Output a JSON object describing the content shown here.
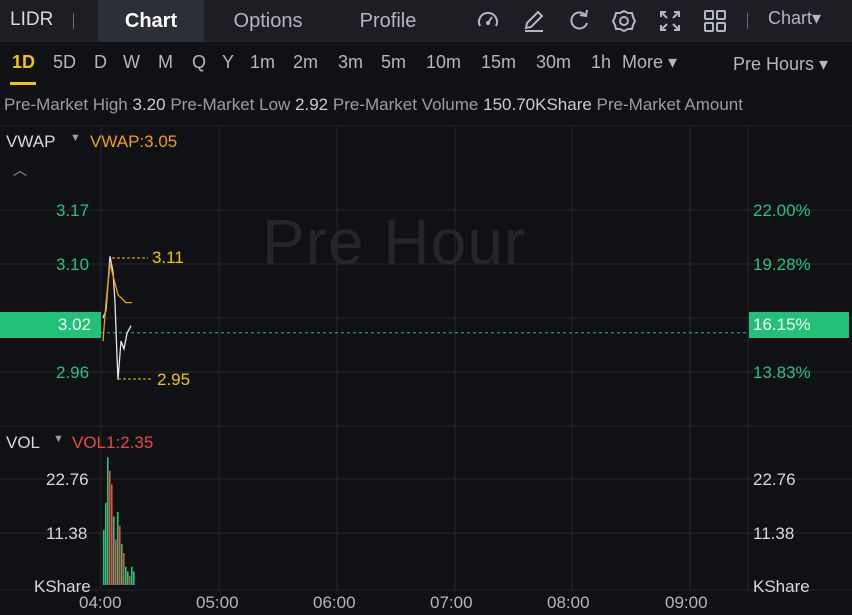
{
  "header": {
    "ticker": "LIDR",
    "tabs": [
      "Chart",
      "Options",
      "Profile"
    ],
    "active_tab": "Chart",
    "chart_menu": "Chart▾",
    "icons": [
      "gauge-icon",
      "draw-icon",
      "refresh-icon",
      "settings-icon",
      "fullscreen-icon",
      "layout-icon"
    ]
  },
  "intervals": {
    "items": [
      "1D",
      "5D",
      "D",
      "W",
      "M",
      "Q",
      "Y",
      "1m",
      "2m",
      "3m",
      "5m",
      "10m",
      "15m",
      "30m",
      "1h"
    ],
    "active": "1D",
    "more": "More ▾",
    "session": "Pre Hours ▾"
  },
  "stats": {
    "high_label": "Pre-Market High",
    "high_value": "3.20",
    "low_label": "Pre-Market Low",
    "low_value": "2.92",
    "volume_label": "Pre-Market Volume",
    "volume_value": "150.70KShare",
    "amount_label": "Pre-Market Amount"
  },
  "price_panel": {
    "indicator": "VWAP",
    "indicator_value": "VWAP:3.05",
    "watermark": "Pre Hour",
    "left_ticks": [
      "3.17",
      "3.10",
      "2.96"
    ],
    "right_ticks": [
      "22.00%",
      "19.28%",
      "13.83%"
    ],
    "current_price": "3.02",
    "current_pct": "16.15%",
    "high_marker": "3.11",
    "low_marker": "2.95",
    "colors": {
      "up": "#26c281",
      "vwap": "#f39c12",
      "marker": "#f1c40f"
    }
  },
  "volume_panel": {
    "indicator": "VOL",
    "indicator_value": "VOL1:2.35",
    "left_ticks": [
      "22.76",
      "11.38",
      "KShare"
    ],
    "right_ticks": [
      "22.76",
      "11.38",
      "KShare"
    ]
  },
  "time_axis": [
    "04:00",
    "05:00",
    "06:00",
    "07:00",
    "08:00",
    "09:00"
  ],
  "chart_data": {
    "type": "line",
    "price_series": [
      3.03,
      3.04,
      3.11,
      3.09,
      3.05,
      2.98,
      2.95,
      3.0,
      2.99,
      3.01,
      3.02
    ],
    "vwap_series": [
      3.0,
      3.05,
      3.1,
      3.08,
      3.06,
      3.055,
      3.05,
      3.05
    ],
    "volume_bars": [
      {
        "v": 12,
        "c": "green"
      },
      {
        "v": 18,
        "c": "green"
      },
      {
        "v": 28,
        "c": "green"
      },
      {
        "v": 25,
        "c": "red"
      },
      {
        "v": 22,
        "c": "red"
      },
      {
        "v": 15,
        "c": "green"
      },
      {
        "v": 10,
        "c": "red"
      },
      {
        "v": 16,
        "c": "green"
      },
      {
        "v": 13,
        "c": "red"
      },
      {
        "v": 9,
        "c": "green"
      },
      {
        "v": 7,
        "c": "red"
      },
      {
        "v": 4,
        "c": "green"
      },
      {
        "v": 3,
        "c": "green"
      },
      {
        "v": 2,
        "c": "red"
      },
      {
        "v": 4,
        "c": "green"
      },
      {
        "v": 3,
        "c": "green"
      }
    ],
    "ylim": [
      2.92,
      3.2
    ],
    "vol_ylim": [
      0,
      30
    ]
  }
}
